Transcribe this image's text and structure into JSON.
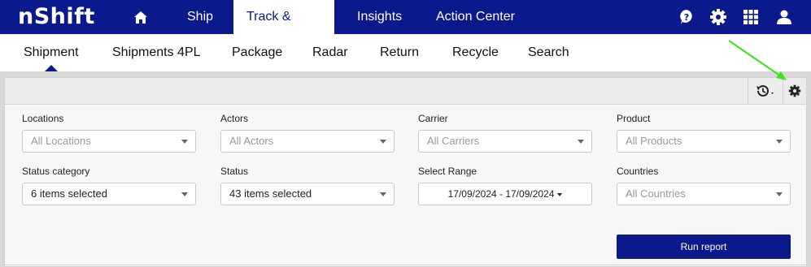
{
  "brand": {
    "logo_text": "nShift"
  },
  "top_nav": {
    "items": [
      {
        "label": "Ship"
      },
      {
        "label": "Track & Trace"
      },
      {
        "label": "Insights"
      },
      {
        "label": "Action Center"
      }
    ],
    "icons": [
      "home-icon",
      "help-icon",
      "gear-icon",
      "grid-icon",
      "user-icon"
    ]
  },
  "sub_nav": {
    "items": [
      {
        "label": "Shipment"
      },
      {
        "label": "Shipments 4PL"
      },
      {
        "label": "Package"
      },
      {
        "label": "Radar"
      },
      {
        "label": "Return"
      },
      {
        "label": "Recycle"
      },
      {
        "label": "Search"
      }
    ]
  },
  "toolbar": {
    "icons": [
      "history-icon",
      "gear-icon"
    ]
  },
  "filters": {
    "locations": {
      "label": "Locations",
      "placeholder": "All Locations"
    },
    "actors": {
      "label": "Actors",
      "placeholder": "All Actors"
    },
    "carrier": {
      "label": "Carrier",
      "placeholder": "All Carriers"
    },
    "product": {
      "label": "Product",
      "placeholder": "All Products"
    },
    "status_category": {
      "label": "Status category",
      "value": "6 items selected"
    },
    "status": {
      "label": "Status",
      "value": "43 items selected"
    },
    "select_range": {
      "label": "Select Range",
      "value": "17/09/2024 - 17/09/2024"
    },
    "countries": {
      "label": "Countries",
      "placeholder": "All Countries"
    }
  },
  "run_report_label": "Run report",
  "colors": {
    "brand": "#0a1a8c",
    "annotation": "#39e51a"
  }
}
